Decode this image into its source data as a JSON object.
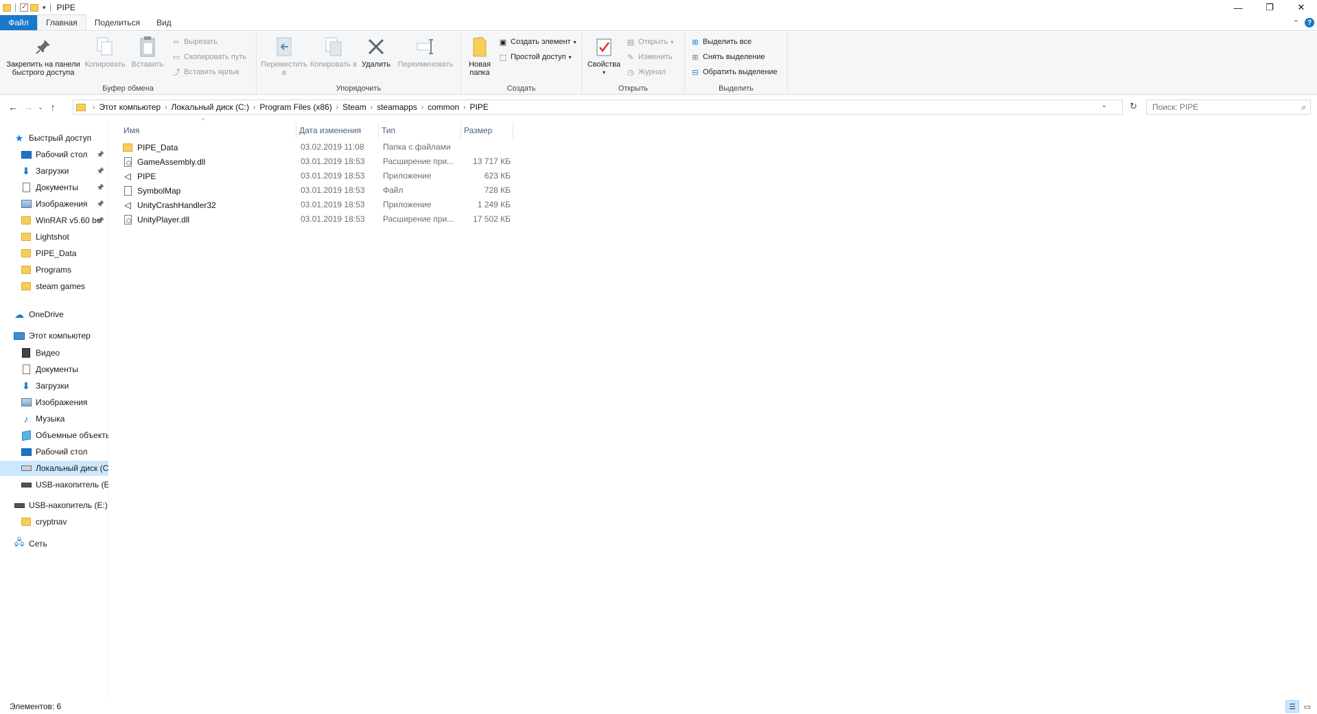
{
  "window": {
    "title": "PIPE",
    "controls": {
      "minimize": "—",
      "maximize": "❐",
      "close": "✕"
    }
  },
  "ribbon_tabs": [
    {
      "label": "Файл"
    },
    {
      "label": "Главная"
    },
    {
      "label": "Поделиться"
    },
    {
      "label": "Вид"
    }
  ],
  "ribbon": {
    "clipboard": {
      "label": "Буфер обмена",
      "pin": "Закрепить на панели быстрого доступа",
      "copy": "Копировать",
      "paste": "Вставить",
      "cut": "Вырезать",
      "copy_path": "Скопировать путь",
      "paste_shortcut": "Вставить ярлык"
    },
    "organize": {
      "label": "Упорядочить",
      "move_to": "Переместить в",
      "copy_to": "Копировать в",
      "delete": "Удалить",
      "rename": "Переименовать"
    },
    "create": {
      "label": "Создать",
      "new_folder": "Новая папка",
      "new_item": "Создать элемент",
      "easy_access": "Простой доступ"
    },
    "open": {
      "label": "Открыть",
      "properties": "Свойства",
      "open": "Открыть",
      "edit": "Изменить",
      "history": "Журнал"
    },
    "select": {
      "label": "Выделить",
      "select_all": "Выделить все",
      "select_none": "Снять выделение",
      "invert": "Обратить выделение"
    }
  },
  "address": {
    "crumbs": [
      "Этот компьютер",
      "Локальный диск (C:)",
      "Program Files (x86)",
      "Steam",
      "steamapps",
      "common",
      "PIPE"
    ]
  },
  "search": {
    "placeholder": "Поиск: PIPE"
  },
  "navpane": {
    "quick_access": "Быстрый доступ",
    "quick_items": [
      {
        "label": "Рабочий стол",
        "icon": "desktop-icon",
        "pinned": true
      },
      {
        "label": "Загрузки",
        "icon": "downloads-icon",
        "pinned": true
      },
      {
        "label": "Документы",
        "icon": "documents-icon",
        "pinned": true
      },
      {
        "label": "Изображения",
        "icon": "pictures-icon",
        "pinned": true
      },
      {
        "label": "WinRAR v5.60 be",
        "icon": "folder-icon",
        "pinned": true
      },
      {
        "label": "Lightshot",
        "icon": "folder-icon",
        "pinned": false
      },
      {
        "label": "PIPE_Data",
        "icon": "folder-icon",
        "pinned": false
      },
      {
        "label": "Programs",
        "icon": "folder-icon",
        "pinned": false
      },
      {
        "label": "steam games",
        "icon": "folder-icon",
        "pinned": false
      }
    ],
    "onedrive": "OneDrive",
    "this_pc": "Этот компьютер",
    "pc_items": [
      {
        "label": "Видео",
        "icon": "video-icon"
      },
      {
        "label": "Документы",
        "icon": "documents-icon"
      },
      {
        "label": "Загрузки",
        "icon": "downloads-icon"
      },
      {
        "label": "Изображения",
        "icon": "pictures-icon"
      },
      {
        "label": "Музыка",
        "icon": "music-icon"
      },
      {
        "label": "Объемные объекты",
        "icon": "3d-objects-icon"
      },
      {
        "label": "Рабочий стол",
        "icon": "desktop-icon"
      },
      {
        "label": "Локальный диск (C:)",
        "icon": "drive-icon"
      },
      {
        "label": "USB-накопитель (E:)",
        "icon": "usb-icon"
      }
    ],
    "usb": "USB-накопитель (E:)",
    "usb_items": [
      {
        "label": "cryptnav",
        "icon": "folder-icon"
      }
    ],
    "network": "Сеть"
  },
  "columns": {
    "name": "Имя",
    "date": "Дата изменения",
    "type": "Тип",
    "size": "Размер"
  },
  "files": [
    {
      "name": "PIPE_Data",
      "date": "03.02.2019 11:08",
      "type": "Папка с файлами",
      "size": "",
      "icon": "folder-icon"
    },
    {
      "name": "GameAssembly.dll",
      "date": "03.01.2019 18:53",
      "type": "Расширение при...",
      "size": "13 717 КБ",
      "icon": "dll-icon"
    },
    {
      "name": "PIPE",
      "date": "03.01.2019 18:53",
      "type": "Приложение",
      "size": "623 КБ",
      "icon": "unity-app-icon"
    },
    {
      "name": "SymbolMap",
      "date": "03.01.2019 18:53",
      "type": "Файл",
      "size": "728 КБ",
      "icon": "file-icon"
    },
    {
      "name": "UnityCrashHandler32",
      "date": "03.01.2019 18:53",
      "type": "Приложение",
      "size": "1 249 КБ",
      "icon": "unity-app-icon"
    },
    {
      "name": "UnityPlayer.dll",
      "date": "03.01.2019 18:53",
      "type": "Расширение при...",
      "size": "17 502 КБ",
      "icon": "dll-icon"
    }
  ],
  "status": {
    "items": "Элементов: 6"
  }
}
